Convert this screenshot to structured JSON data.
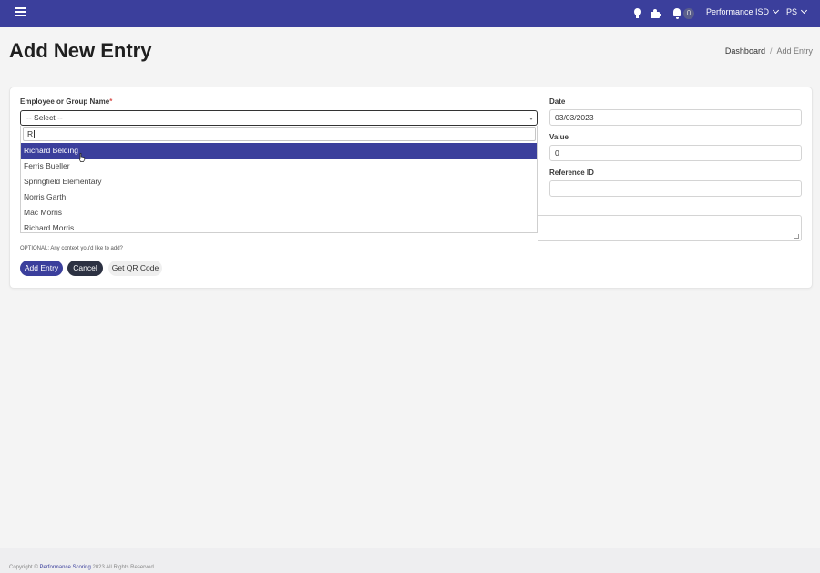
{
  "topbar": {
    "org_name": "Performance ISD",
    "user_initials": "PS",
    "notification_count": "0"
  },
  "page": {
    "title": "Add New Entry",
    "breadcrumb": [
      "Dashboard",
      "Add Entry"
    ]
  },
  "form": {
    "employee_label": "Employee or Group Name",
    "required_mark": "*",
    "select_value": "-- Select --",
    "search_value": "R",
    "options": [
      "Richard Belding",
      "Ferris Bueller",
      "Springfield Elementary",
      "Norris Garth",
      "Mac Morris",
      "Richard Morris"
    ],
    "highlighted_option": "Richard Belding",
    "date_label": "Date",
    "date_value": "03/03/2023",
    "value_label": "Value",
    "value_value": "0",
    "reference_label": "Reference ID",
    "reference_value": "",
    "comment_help": "OPTIONAL: Any context you'd like to add?",
    "buttons": {
      "add": "Add Entry",
      "cancel": "Cancel",
      "qr": "Get QR Code"
    }
  },
  "footer": {
    "copyright": "Copyright ©",
    "brand": "Performance Scoring",
    "rights": "2023 All Rights Reserved"
  },
  "colors": {
    "brand": "#3b3f9c",
    "cancel_button": "#2c3142",
    "required": "#d9534f"
  },
  "icons": [
    "menu-icon",
    "lightbulb-icon",
    "puzzle-icon",
    "bell-icon",
    "chevron-down-icon"
  ]
}
